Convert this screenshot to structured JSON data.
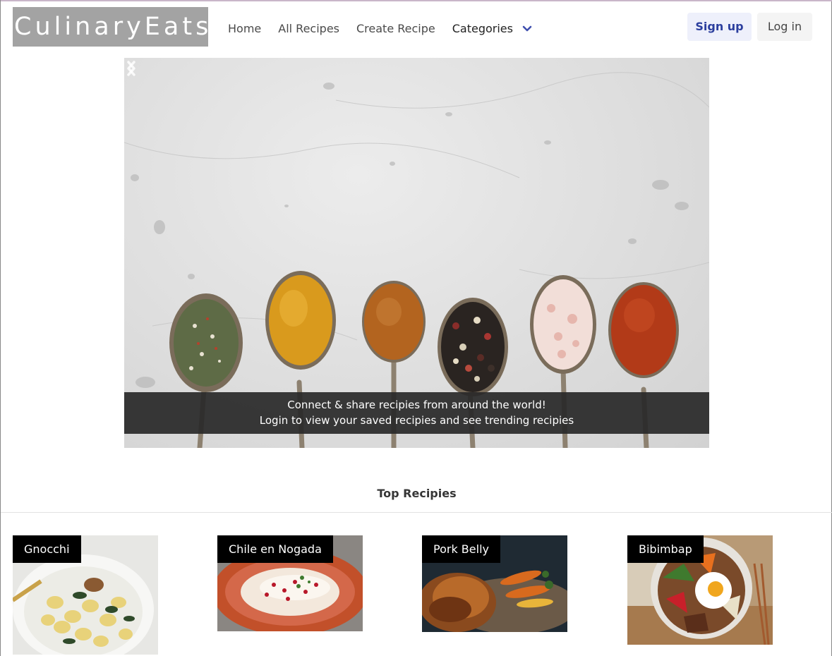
{
  "brand": "CulinaryEats",
  "nav": {
    "home": "Home",
    "all_recipes": "All Recipes",
    "create_recipe": "Create Recipe",
    "categories": "Categories"
  },
  "auth": {
    "signup": "Sign up",
    "login": "Log in"
  },
  "hero": {
    "caption_line1": "Connect & share recipies from around the world!",
    "caption_line2": "Login to view your saved recipies and see trending recipies"
  },
  "top_recipes": {
    "title": "Top Recipies",
    "items": [
      {
        "name": "Gnocchi"
      },
      {
        "name": "Chile en Nogada"
      },
      {
        "name": "Pork Belly"
      },
      {
        "name": "Bibimbap"
      }
    ]
  },
  "colors": {
    "brand_bg": "#a3a3a3",
    "signup_text": "#2c3f9e",
    "caption_bg": "#282828"
  }
}
